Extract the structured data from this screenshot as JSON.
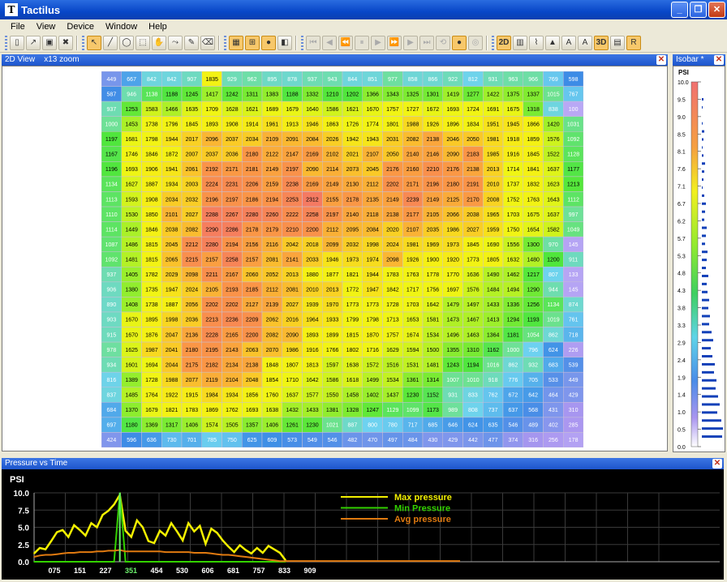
{
  "window": {
    "title": "Tactilus",
    "min_icon": "minimize-icon",
    "max_icon": "maximize-icon",
    "close_icon": "close-icon"
  },
  "menu": [
    "File",
    "View",
    "Device",
    "Window",
    "Help"
  ],
  "toolbar": {
    "file_icons": [
      "new-file-icon",
      "open-icon",
      "save-icon",
      "stop-icon"
    ],
    "tool_icons": [
      "pointer-icon",
      "line-icon",
      "ellipse-icon",
      "rect-select-icon",
      "hand-icon",
      "path-icon",
      "freehand-icon",
      "eraser-icon"
    ],
    "grid_icons": [
      "grid-icon",
      "grid-link-icon",
      "color-map-icon",
      "palette-icon"
    ],
    "playback_icons": [
      "skip-start-icon",
      "prev-icon",
      "rewind-icon",
      "pause-icon",
      "play-icon",
      "forward-icon",
      "next-icon",
      "skip-end-icon",
      "loop-icon",
      "record-icon",
      "snapshot-icon"
    ],
    "view_buttons": [
      "2D",
      "3D"
    ],
    "view_icons": [
      "chart-bar-icon",
      "chart-line-icon",
      "peak-icon",
      "text-a-icon",
      "text-a2-icon",
      "report-icon",
      "reset-icon"
    ]
  },
  "view2d": {
    "title": "2D View",
    "zoom": "x13 zoom"
  },
  "isobar": {
    "title": "Isobar *",
    "unit": "PSI",
    "labels": [
      "10.0",
      "9.5",
      "9.0",
      "8.5",
      "8.1",
      "7.6",
      "7.1",
      "6.7",
      "6.2",
      "5.7",
      "5.3",
      "4.8",
      "4.3",
      "3.8",
      "3.3",
      "2.9",
      "2.4",
      "1.9",
      "1.4",
      "1.0",
      "0.5",
      "0.0"
    ]
  },
  "pressure_grid": {
    "cols": 23,
    "rows": [
      [
        449,
        667,
        842,
        842,
        907,
        1835,
        929,
        962,
        895,
        878,
        937,
        943,
        844,
        851,
        977,
        858,
        866,
        922,
        812,
        931,
        963,
        966,
        769,
        598,
        73
      ],
      [
        587,
        946,
        1138,
        1188,
        1245,
        1417,
        1242,
        1311,
        1383,
        1188,
        1332,
        1210,
        1202,
        1366,
        1343,
        1325,
        1301,
        1419,
        1277,
        1422,
        1375,
        1337,
        1015,
        767,
        98
      ],
      [
        937,
        1253,
        1583,
        1466,
        1635,
        1709,
        1628,
        1621,
        1689,
        1679,
        1640,
        1586,
        1621,
        1670,
        1757,
        1727,
        1672,
        1693,
        1724,
        1691,
        1675,
        1318,
        838,
        100
      ],
      [
        1000,
        1453,
        1738,
        1796,
        1845,
        1893,
        1908,
        1914,
        1961,
        1913,
        1946,
        1863,
        1726,
        1774,
        1801,
        1988,
        1926,
        1896,
        1834,
        1951,
        1945,
        1866,
        1420,
        1031,
        96
      ],
      [
        1197,
        1681,
        1798,
        1944,
        2017,
        2096,
        2037,
        2034,
        2109,
        2091,
        2084,
        2026,
        1942,
        1943,
        2031,
        2082,
        2138,
        2046,
        2050,
        1981,
        1918,
        1859,
        1576,
        1092,
        122
      ],
      [
        1167,
        1746,
        1846,
        1872,
        2007,
        2037,
        2036,
        2180,
        2122,
        2147,
        2169,
        2102,
        2021,
        2107,
        2050,
        2140,
        2146,
        2090,
        2183,
        1985,
        1916,
        1845,
        1522,
        1128,
        115
      ],
      [
        1196,
        1693,
        1906,
        1941,
        2061,
        2192,
        2171,
        2181,
        2149,
        2197,
        2090,
        2114,
        2073,
        2045,
        2176,
        2160,
        2210,
        2176,
        2138,
        2013,
        1714,
        1841,
        1637,
        1177,
        141
      ],
      [
        1134,
        1627,
        1887,
        1934,
        2003,
        2224,
        2231,
        2206,
        2159,
        2238,
        2169,
        2149,
        2130,
        2112,
        2202,
        2171,
        2196,
        2180,
        2191,
        2010,
        1737,
        1832,
        1623,
        1213,
        183
      ],
      [
        1113,
        1593,
        1908,
        2034,
        2032,
        2196,
        2197,
        2186,
        2194,
        2253,
        2312,
        2155,
        2178,
        2135,
        2149,
        2239,
        2149,
        2125,
        2170,
        2008,
        1752,
        1763,
        1643,
        1112,
        194
      ],
      [
        1110,
        1530,
        1850,
        2101,
        2027,
        2288,
        2267,
        2280,
        2260,
        2222,
        2258,
        2197,
        2140,
        2118,
        2138,
        2177,
        2105,
        2066,
        2038,
        1965,
        1703,
        1675,
        1637,
        997,
        195
      ],
      [
        1114,
        1449,
        1846,
        2038,
        2082,
        2290,
        2286,
        2178,
        2179,
        2210,
        2200,
        2112,
        2095,
        2084,
        2020,
        2107,
        2035,
        1986,
        2027,
        1959,
        1750,
        1654,
        1582,
        1049,
        161
      ],
      [
        1087,
        1486,
        1815,
        2045,
        2212,
        2280,
        2194,
        2156,
        2116,
        2042,
        2018,
        2099,
        2032,
        1998,
        2024,
        1981,
        1969,
        1973,
        1845,
        1690,
        1556,
        1300,
        970,
        145
      ],
      [
        1092,
        1481,
        1815,
        2065,
        2215,
        2157,
        2258,
        2157,
        2081,
        2141,
        2033,
        1946,
        1973,
        1974,
        2098,
        1926,
        1900,
        1920,
        1773,
        1805,
        1632,
        1480,
        1200,
        911,
        145
      ],
      [
        937,
        1405,
        1782,
        2029,
        2098,
        2211,
        2167,
        2060,
        2052,
        2013,
        1880,
        1877,
        1821,
        1944,
        1783,
        1763,
        1778,
        1770,
        1636,
        1490,
        1462,
        1217,
        807,
        133
      ],
      [
        906,
        1380,
        1735,
        1947,
        2024,
        2105,
        2193,
        2185,
        2112,
        2081,
        2010,
        2013,
        1772,
        1947,
        1842,
        1717,
        1756,
        1697,
        1576,
        1484,
        1494,
        1290,
        944,
        145
      ],
      [
        890,
        1408,
        1738,
        1887,
        2056,
        2202,
        2202,
        2127,
        2139,
        2027,
        1939,
        1970,
        1773,
        1773,
        1728,
        1703,
        1642,
        1479,
        1497,
        1433,
        1336,
        1256,
        1134,
        874,
        146
      ],
      [
        903,
        1670,
        1895,
        1998,
        2036,
        2213,
        2236,
        2209,
        2062,
        2016,
        1964,
        1933,
        1799,
        1798,
        1713,
        1653,
        1581,
        1473,
        1467,
        1413,
        1294,
        1193,
        1019,
        761,
        246
      ],
      [
        915,
        1670,
        1876,
        2047,
        2136,
        2228,
        2165,
        2200,
        2082,
        2090,
        1893,
        1899,
        1815,
        1870,
        1757,
        1674,
        1534,
        1496,
        1463,
        1364,
        1181,
        1054,
        862,
        718,
        239
      ],
      [
        978,
        1625,
        1987,
        2041,
        2180,
        2195,
        2143,
        2063,
        2070,
        1986,
        1916,
        1766,
        1802,
        1716,
        1629,
        1594,
        1500,
        1355,
        1310,
        1162,
        1000,
        796,
        624,
        226
      ],
      [
        934,
        1601,
        1694,
        2044,
        2175,
        2182,
        2134,
        2138,
        1848,
        1807,
        1813,
        1597,
        1638,
        1572,
        1516,
        1531,
        1481,
        1243,
        1194,
        1016,
        862,
        932,
        683,
        539,
        186
      ],
      [
        816,
        1389,
        1728,
        1988,
        2077,
        2119,
        2104,
        2048,
        1854,
        1710,
        1642,
        1586,
        1618,
        1499,
        1534,
        1361,
        1314,
        1007,
        1010,
        918,
        776,
        705,
        533,
        449,
        140
      ],
      [
        837,
        1485,
        1764,
        1922,
        1915,
        1984,
        1934,
        1856,
        1760,
        1637,
        1577,
        1550,
        1458,
        1402,
        1437,
        1230,
        1152,
        931,
        833,
        762,
        672,
        642,
        464,
        429,
        117
      ],
      [
        684,
        1370,
        1679,
        1821,
        1783,
        1869,
        1762,
        1693,
        1638,
        1432,
        1433,
        1381,
        1328,
        1247,
        1129,
        1099,
        1173,
        989,
        808,
        737,
        637,
        568,
        431,
        310,
        94
      ],
      [
        697,
        1180,
        1369,
        1317,
        1406,
        1574,
        1505,
        1357,
        1406,
        1261,
        1230,
        1021,
        887,
        800,
        780,
        717,
        685,
        646,
        624,
        635,
        546,
        489,
        402,
        285,
        74
      ],
      [
        424,
        596,
        636,
        730,
        701,
        785,
        750,
        625,
        609,
        573,
        549,
        546,
        482,
        470,
        497,
        484,
        430,
        429,
        442,
        477,
        374,
        316,
        256,
        178,
        47
      ]
    ]
  },
  "pressure_chart": {
    "panel_title": "Pressure vs Time",
    "y_label": "PSI",
    "y_ticks": [
      "10.0",
      "7.5",
      "5.0",
      "2.5",
      "0.0"
    ],
    "x_ticks": [
      "075",
      "151",
      "227",
      "351",
      "454",
      "530",
      "606",
      "681",
      "757",
      "833",
      "909"
    ],
    "highlight_tick": "351",
    "legend": [
      "Max pressure",
      "Min Pressure",
      "Avg pressure"
    ],
    "colors": {
      "max": "#f3f000",
      "min": "#33d100",
      "avg": "#e07a10",
      "highlight": "#6cf06c"
    }
  },
  "chart_data": {
    "type": "line",
    "ylim": [
      0,
      10
    ],
    "x": [
      0,
      20,
      40,
      60,
      80,
      100,
      120,
      140,
      160,
      180,
      200,
      220,
      240,
      260,
      280,
      300,
      320,
      340,
      360,
      380,
      400,
      420,
      440,
      460,
      480,
      500,
      520,
      540,
      560,
      580,
      600,
      620,
      640,
      660,
      680,
      700,
      720,
      740,
      760,
      780,
      800,
      820,
      840,
      860,
      880
    ],
    "series": [
      {
        "name": "Max pressure",
        "values": [
          1.2,
          2.0,
          1.8,
          3.0,
          4.3,
          4.6,
          3.6,
          5.3,
          4.6,
          3.8,
          5.6,
          5.0,
          6.8,
          7.4,
          8.3,
          9.7,
          4.5,
          3.6,
          6.0,
          5.0,
          3.0,
          2.7,
          4.5,
          3.8,
          5.6,
          4.4,
          3.1,
          5.6,
          4.4,
          5.2,
          2.6,
          4.8,
          4.2,
          3.1,
          2.2,
          1.4,
          2.4,
          1.7,
          1.2,
          2.0,
          1.3,
          2.3,
          1.8,
          1.3,
          0.2
        ]
      },
      {
        "name": "Min Pressure",
        "values": [
          0,
          0,
          0,
          0,
          0,
          0,
          0,
          0,
          0,
          0,
          0,
          0,
          0,
          0,
          0,
          10.0,
          0,
          0,
          0,
          0,
          0,
          0,
          0,
          0,
          0,
          0,
          0,
          0,
          0,
          0,
          0,
          0,
          0,
          0,
          0,
          0,
          0,
          0,
          0,
          0,
          0,
          0,
          0,
          0,
          0
        ]
      },
      {
        "name": "Avg pressure",
        "values": [
          0.7,
          0.9,
          1.0,
          1.0,
          1.1,
          1.2,
          1.3,
          1.3,
          1.4,
          1.4,
          1.4,
          1.5,
          1.5,
          1.6,
          1.6,
          1.7,
          1.5,
          1.5,
          1.5,
          1.5,
          1.5,
          1.5,
          1.5,
          1.4,
          1.4,
          1.4,
          1.4,
          1.4,
          1.3,
          1.3,
          1.3,
          1.2,
          1.1,
          1.0,
          1.0,
          0.9,
          0.8,
          0.7,
          0.6,
          0.5,
          0.4,
          0.3,
          0.2,
          0.1,
          0.1
        ]
      }
    ]
  }
}
